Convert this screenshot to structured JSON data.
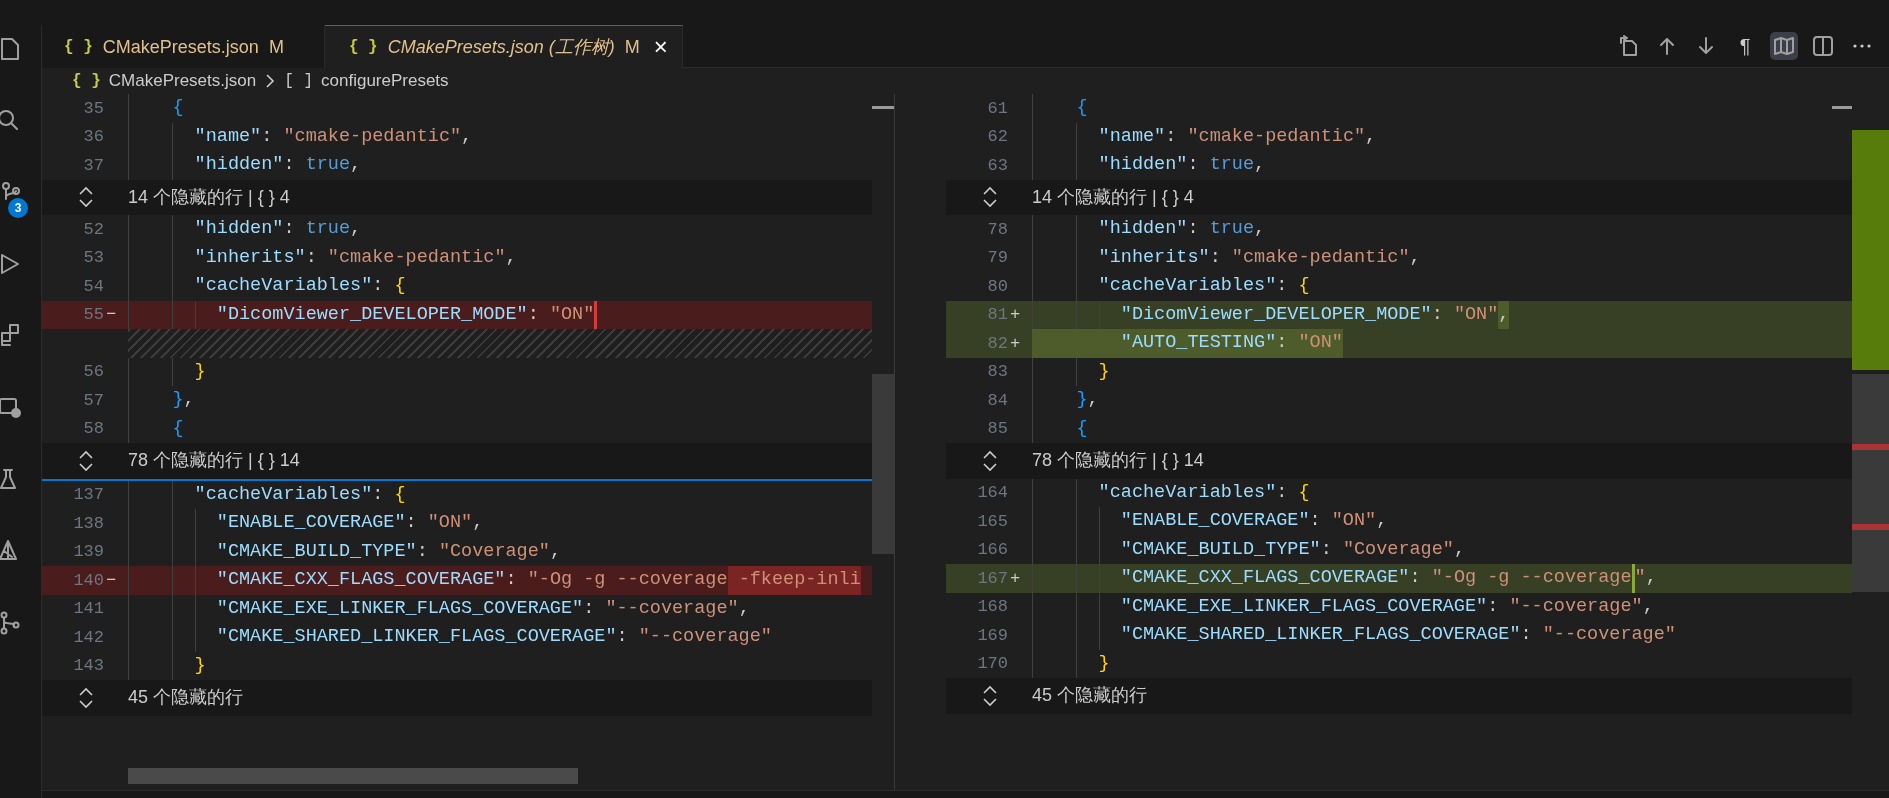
{
  "activity_bar": {
    "badge": "3"
  },
  "tabs": [
    {
      "icon": "{ }",
      "label": "CMakePresets.json",
      "status": "M",
      "selected": false,
      "preview": false
    },
    {
      "icon": "{ }",
      "label": "CMakePresets.json (工作树)",
      "status": "M",
      "selected": true,
      "preview": true,
      "close": "×"
    }
  ],
  "toolbar": [
    {
      "kind": "open-file",
      "selected": false
    },
    {
      "kind": "up",
      "selected": false
    },
    {
      "kind": "down",
      "selected": false
    },
    {
      "kind": "glyph",
      "glyph": "¶",
      "selected": false
    },
    {
      "kind": "map",
      "selected": true
    },
    {
      "kind": "split",
      "selected": false
    },
    {
      "kind": "more",
      "selected": false
    }
  ],
  "breadcrumb": [
    {
      "icon": "{ }",
      "label": "CMakePresets.json"
    },
    {
      "icon": "[ ]",
      "label": "configurePresets"
    }
  ],
  "panes": [
    {
      "rows": [
        {
          "kind": "code",
          "n": "35",
          "code": [
            {
              "kind": "brace2",
              "text": "    {"
            }
          ]
        },
        {
          "kind": "code",
          "n": "36",
          "code": [
            {
              "kind": "key",
              "text": "      \"name\""
            },
            {
              "kind": "punct",
              "text": ": "
            },
            {
              "kind": "string",
              "text": "\"cmake-pedantic\""
            },
            {
              "kind": "punct",
              "text": ","
            }
          ]
        },
        {
          "kind": "code",
          "n": "37",
          "code": [
            {
              "kind": "key",
              "text": "      \"hidden\""
            },
            {
              "kind": "punct",
              "text": ": "
            },
            {
              "kind": "bool",
              "text": "true"
            },
            {
              "kind": "punct",
              "text": ","
            }
          ]
        },
        {
          "kind": "fold",
          "text": "14 个隐藏的行 | { } 4"
        },
        {
          "kind": "code",
          "n": "52",
          "code": [
            {
              "kind": "key",
              "text": "      \"hidden\""
            },
            {
              "kind": "punct",
              "text": ": "
            },
            {
              "kind": "bool",
              "text": "true"
            },
            {
              "kind": "punct",
              "text": ","
            }
          ]
        },
        {
          "kind": "code",
          "n": "53",
          "code": [
            {
              "kind": "key",
              "text": "      \"inherits\""
            },
            {
              "kind": "punct",
              "text": ": "
            },
            {
              "kind": "string",
              "text": "\"cmake-pedantic\""
            },
            {
              "kind": "punct",
              "text": ","
            }
          ]
        },
        {
          "kind": "code",
          "n": "54",
          "code": [
            {
              "kind": "key",
              "text": "      \"cacheVariables\""
            },
            {
              "kind": "punct",
              "text": ": "
            },
            {
              "kind": "brace1",
              "text": "{"
            }
          ]
        },
        {
          "kind": "code",
          "n": "55",
          "removed": true,
          "marker": "−",
          "code": [
            {
              "kind": "key",
              "text": "        \"DicomViewer_DEVELOPER_MODE\""
            },
            {
              "kind": "punct",
              "text": ": "
            },
            {
              "kind": "string",
              "text": "\"ON\"",
              "bar": true
            }
          ]
        },
        {
          "kind": "filler"
        },
        {
          "kind": "code",
          "n": "56",
          "code": [
            {
              "kind": "brace1",
              "text": "      }"
            }
          ]
        },
        {
          "kind": "code",
          "n": "57",
          "code": [
            {
              "kind": "brace2",
              "text": "    }"
            },
            {
              "kind": "punct",
              "text": ","
            }
          ]
        },
        {
          "kind": "code",
          "n": "58",
          "code": [
            {
              "kind": "brace2",
              "text": "    {"
            }
          ]
        },
        {
          "kind": "fold",
          "text": "78 个隐藏的行 | { } 14",
          "divider_below": true
        },
        {
          "kind": "code",
          "n": "137",
          "code": [
            {
              "kind": "key",
              "text": "      \"cacheVariables\""
            },
            {
              "kind": "punct",
              "text": ": "
            },
            {
              "kind": "brace1",
              "text": "{"
            }
          ]
        },
        {
          "kind": "code",
          "n": "138",
          "code": [
            {
              "kind": "key",
              "text": "        \"ENABLE_COVERAGE\""
            },
            {
              "kind": "punct",
              "text": ": "
            },
            {
              "kind": "string",
              "text": "\"ON\""
            },
            {
              "kind": "punct",
              "text": ","
            }
          ]
        },
        {
          "kind": "code",
          "n": "139",
          "code": [
            {
              "kind": "key",
              "text": "        \"CMAKE_BUILD_TYPE\""
            },
            {
              "kind": "punct",
              "text": ": "
            },
            {
              "kind": "string",
              "text": "\"Coverage\""
            },
            {
              "kind": "punct",
              "text": ","
            }
          ]
        },
        {
          "kind": "code",
          "n": "140",
          "removed": true,
          "marker": "−",
          "code": [
            {
              "kind": "key",
              "text": "        \"CMAKE_CXX_FLAGS_COVERAGE\""
            },
            {
              "kind": "punct",
              "text": ": "
            },
            {
              "kind": "string",
              "text": "\"-Og -g --coverage"
            },
            {
              "kind": "string",
              "text": " -fkeep-inli",
              "hl": true
            }
          ]
        },
        {
          "kind": "code",
          "n": "141",
          "code": [
            {
              "kind": "key",
              "text": "        \"CMAKE_EXE_LINKER_FLAGS_COVERAGE\""
            },
            {
              "kind": "punct",
              "text": ": "
            },
            {
              "kind": "string",
              "text": "\"--coverage\""
            },
            {
              "kind": "punct",
              "text": ","
            }
          ]
        },
        {
          "kind": "code",
          "n": "142",
          "code": [
            {
              "kind": "key",
              "text": "        \"CMAKE_SHARED_LINKER_FLAGS_COVERAGE\""
            },
            {
              "kind": "punct",
              "text": ": "
            },
            {
              "kind": "string",
              "text": "\"--coverage\""
            }
          ]
        },
        {
          "kind": "code",
          "n": "143",
          "code": [
            {
              "kind": "brace1",
              "text": "      }"
            }
          ]
        },
        {
          "kind": "fold",
          "text": "45 个隐藏的行"
        }
      ]
    },
    {
      "rows": [
        {
          "kind": "code",
          "n": "61",
          "code": [
            {
              "kind": "brace2",
              "text": "    {"
            }
          ]
        },
        {
          "kind": "code",
          "n": "62",
          "code": [
            {
              "kind": "key",
              "text": "      \"name\""
            },
            {
              "kind": "punct",
              "text": ": "
            },
            {
              "kind": "string",
              "text": "\"cmake-pedantic\""
            },
            {
              "kind": "punct",
              "text": ","
            }
          ]
        },
        {
          "kind": "code",
          "n": "63",
          "code": [
            {
              "kind": "key",
              "text": "      \"hidden\""
            },
            {
              "kind": "punct",
              "text": ": "
            },
            {
              "kind": "bool",
              "text": "true"
            },
            {
              "kind": "punct",
              "text": ","
            }
          ]
        },
        {
          "kind": "fold",
          "text": "14 个隐藏的行 | { } 4"
        },
        {
          "kind": "code",
          "n": "78",
          "code": [
            {
              "kind": "key",
              "text": "      \"hidden\""
            },
            {
              "kind": "punct",
              "text": ": "
            },
            {
              "kind": "bool",
              "text": "true"
            },
            {
              "kind": "punct",
              "text": ","
            }
          ]
        },
        {
          "kind": "code",
          "n": "79",
          "code": [
            {
              "kind": "key",
              "text": "      \"inherits\""
            },
            {
              "kind": "punct",
              "text": ": "
            },
            {
              "kind": "string",
              "text": "\"cmake-pedantic\""
            },
            {
              "kind": "punct",
              "text": ","
            }
          ]
        },
        {
          "kind": "code",
          "n": "80",
          "code": [
            {
              "kind": "key",
              "text": "      \"cacheVariables\""
            },
            {
              "kind": "punct",
              "text": ": "
            },
            {
              "kind": "brace1",
              "text": "{"
            }
          ]
        },
        {
          "kind": "code",
          "n": "81",
          "added": true,
          "marker": "+",
          "code": [
            {
              "kind": "key",
              "text": "        \"DicomViewer_DEVELOPER_MODE\""
            },
            {
              "kind": "punct",
              "text": ": "
            },
            {
              "kind": "string",
              "text": "\"ON\""
            },
            {
              "kind": "punct",
              "text": ",",
              "hl": true
            }
          ]
        },
        {
          "kind": "code",
          "n": "82",
          "added": true,
          "marker": "+",
          "code": [
            {
              "kind": "key",
              "text": "        \"AUTO_TESTING\"",
              "hl": true
            },
            {
              "kind": "punct",
              "text": ": ",
              "hl": true
            },
            {
              "kind": "string",
              "text": "\"ON\"",
              "hl": true
            }
          ]
        },
        {
          "kind": "code",
          "n": "83",
          "code": [
            {
              "kind": "brace1",
              "text": "      }"
            }
          ]
        },
        {
          "kind": "code",
          "n": "84",
          "code": [
            {
              "kind": "brace2",
              "text": "    }"
            },
            {
              "kind": "punct",
              "text": ","
            }
          ]
        },
        {
          "kind": "code",
          "n": "85",
          "code": [
            {
              "kind": "brace2",
              "text": "    {"
            }
          ]
        },
        {
          "kind": "fold",
          "text": "78 个隐藏的行 | { } 14"
        },
        {
          "kind": "code",
          "n": "164",
          "code": [
            {
              "kind": "key",
              "text": "      \"cacheVariables\""
            },
            {
              "kind": "punct",
              "text": ": "
            },
            {
              "kind": "brace1",
              "text": "{"
            }
          ]
        },
        {
          "kind": "code",
          "n": "165",
          "code": [
            {
              "kind": "key",
              "text": "        \"ENABLE_COVERAGE\""
            },
            {
              "kind": "punct",
              "text": ": "
            },
            {
              "kind": "string",
              "text": "\"ON\""
            },
            {
              "kind": "punct",
              "text": ","
            }
          ]
        },
        {
          "kind": "code",
          "n": "166",
          "code": [
            {
              "kind": "key",
              "text": "        \"CMAKE_BUILD_TYPE\""
            },
            {
              "kind": "punct",
              "text": ": "
            },
            {
              "kind": "string",
              "text": "\"Coverage\""
            },
            {
              "kind": "punct",
              "text": ","
            }
          ]
        },
        {
          "kind": "code",
          "n": "167",
          "added": true,
          "marker": "+",
          "code": [
            {
              "kind": "key",
              "text": "        \"CMAKE_CXX_FLAGS_COVERAGE\""
            },
            {
              "kind": "punct",
              "text": ": "
            },
            {
              "kind": "string",
              "text": "\"-Og -g --coverage",
              "bar": true
            },
            {
              "kind": "string",
              "text": "\""
            },
            {
              "kind": "punct",
              "text": ","
            }
          ]
        },
        {
          "kind": "code",
          "n": "168",
          "code": [
            {
              "kind": "key",
              "text": "        \"CMAKE_EXE_LINKER_FLAGS_COVERAGE\""
            },
            {
              "kind": "punct",
              "text": ": "
            },
            {
              "kind": "string",
              "text": "\"--coverage\""
            },
            {
              "kind": "punct",
              "text": ","
            }
          ]
        },
        {
          "kind": "code",
          "n": "169",
          "code": [
            {
              "kind": "key",
              "text": "        \"CMAKE_SHARED_LINKER_FLAGS_COVERAGE\""
            },
            {
              "kind": "punct",
              "text": ": "
            },
            {
              "kind": "string",
              "text": "\"--coverage\""
            }
          ]
        },
        {
          "kind": "code",
          "n": "170",
          "code": [
            {
              "kind": "brace1",
              "text": "      }"
            }
          ]
        },
        {
          "kind": "fold",
          "text": "45 个隐藏的行"
        }
      ]
    }
  ]
}
